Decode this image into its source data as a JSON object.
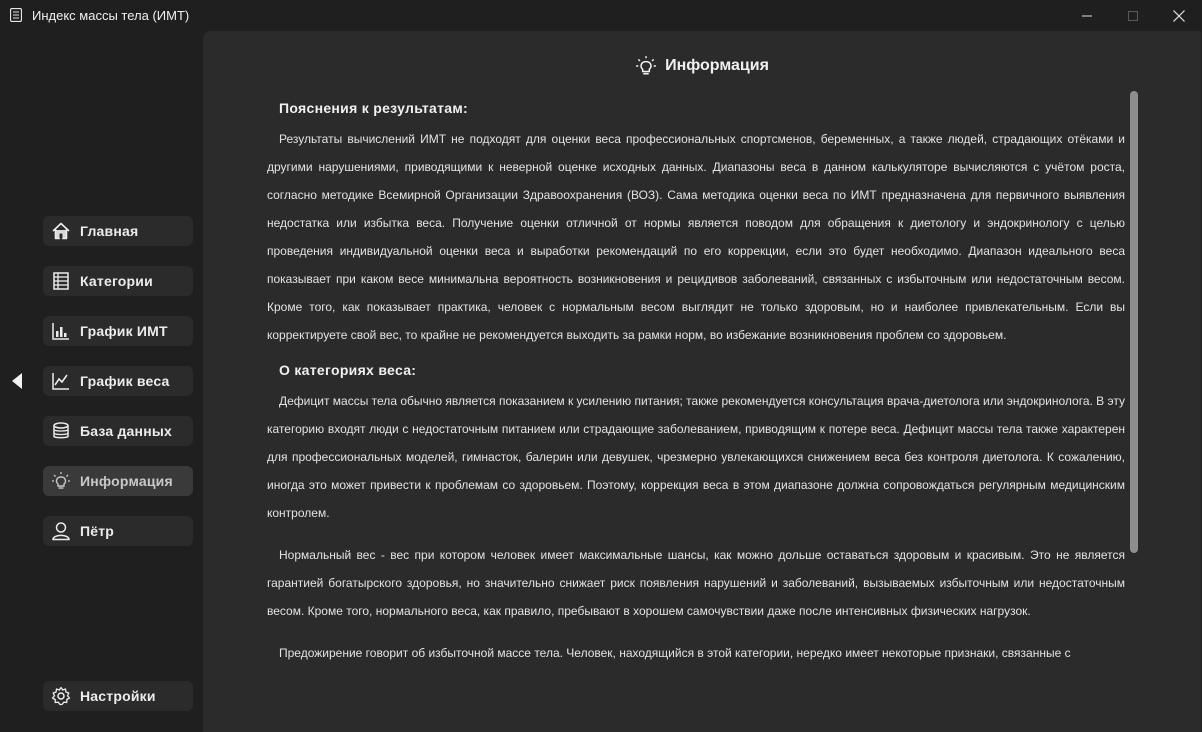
{
  "window": {
    "title": "Индекс массы тела (ИМТ)"
  },
  "sidebar": {
    "items": [
      {
        "label": "Главная",
        "icon": "home-icon"
      },
      {
        "label": "Категории",
        "icon": "categories-icon"
      },
      {
        "label": "График ИМТ",
        "icon": "bar-chart-icon"
      },
      {
        "label": "График веса",
        "icon": "line-chart-icon"
      },
      {
        "label": "База данных",
        "icon": "database-icon"
      },
      {
        "label": "Информация",
        "icon": "lightbulb-icon",
        "active": true
      },
      {
        "label": "Пётр",
        "icon": "user-icon"
      }
    ],
    "settings_label": "Настройки"
  },
  "main": {
    "header_title": "Информация",
    "section1_title": "Пояснения к результатам:",
    "section1_text": "Результаты вычислений ИМТ не подходят для оценки веса профессиональных спортсменов, беременных, а также людей, страдающих отёками и другими нарушениями, приводящими к неверной оценке исходных данных. Диапазоны веса в данном калькуляторе вычисляются с учётом роста, согласно методике Всемирной Организации Здравоохранения (ВОЗ). Сама методика оценки веса по ИМТ предназначена для первичного выявления недостатка или избытка веса. Получение оценки отличной от нормы является поводом для обращения к диетологу и эндокринологу с целью проведения индивидуальной оценки веса и выработки рекомендаций по его коррекции, если это будет необходимо. Диапазон идеального веса показывает при каком весе минимальна вероятность возникновения и рецидивов заболеваний, связанных с избыточным или недостаточным весом. Кроме того, как показывает практика, человек с нормальным весом выглядит не только здоровым, но и наиболее привлекательным. Если вы корректируете свой вес, то крайне не рекомендуется выходить за рамки норм, во избежание возникновения проблем со здоровьем.",
    "section2_title": "О категориях веса:",
    "para_deficit": "Дефицит массы тела обычно является показанием к усилению питания; также рекомендуется консультация врача-диетолога или эндокринолога. В эту категорию входят люди с недостаточным питанием или страдающие заболеванием, приводящим к потере веса. Дефицит массы тела также характерен для профессиональных моделей, гимнасток, балерин или девушек, чрезмерно увлекающихся снижением веса без контроля диетолога. К сожалению, иногда это может привести к проблемам со здоровьем. Поэтому, коррекция веса в этом диапазоне должна сопровождаться регулярным медицинским контролем.",
    "para_normal": "Нормальный вес - вес при котором человек имеет максимальные шансы, как можно дольше оставаться здоровым и красивым. Это не является гарантией богатырского здоровья, но значительно снижает риск появления нарушений и заболеваний, вызываемых избыточным или недостаточным весом. Кроме того, нормального веса, как правило, пребывают в хорошем самочувствии даже после интенсивных физических нагрузок.",
    "para_preobesity": "Предожирение говорит об избыточной массе тела. Человек, находящийся в этой категории, нередко имеет некоторые признаки, связанные с"
  },
  "colors": {
    "window_bg": "#1f1f1f",
    "panel_bg": "#2b2b2b",
    "nav_active": "#3a3a3a",
    "text": "#e6e6e6"
  }
}
